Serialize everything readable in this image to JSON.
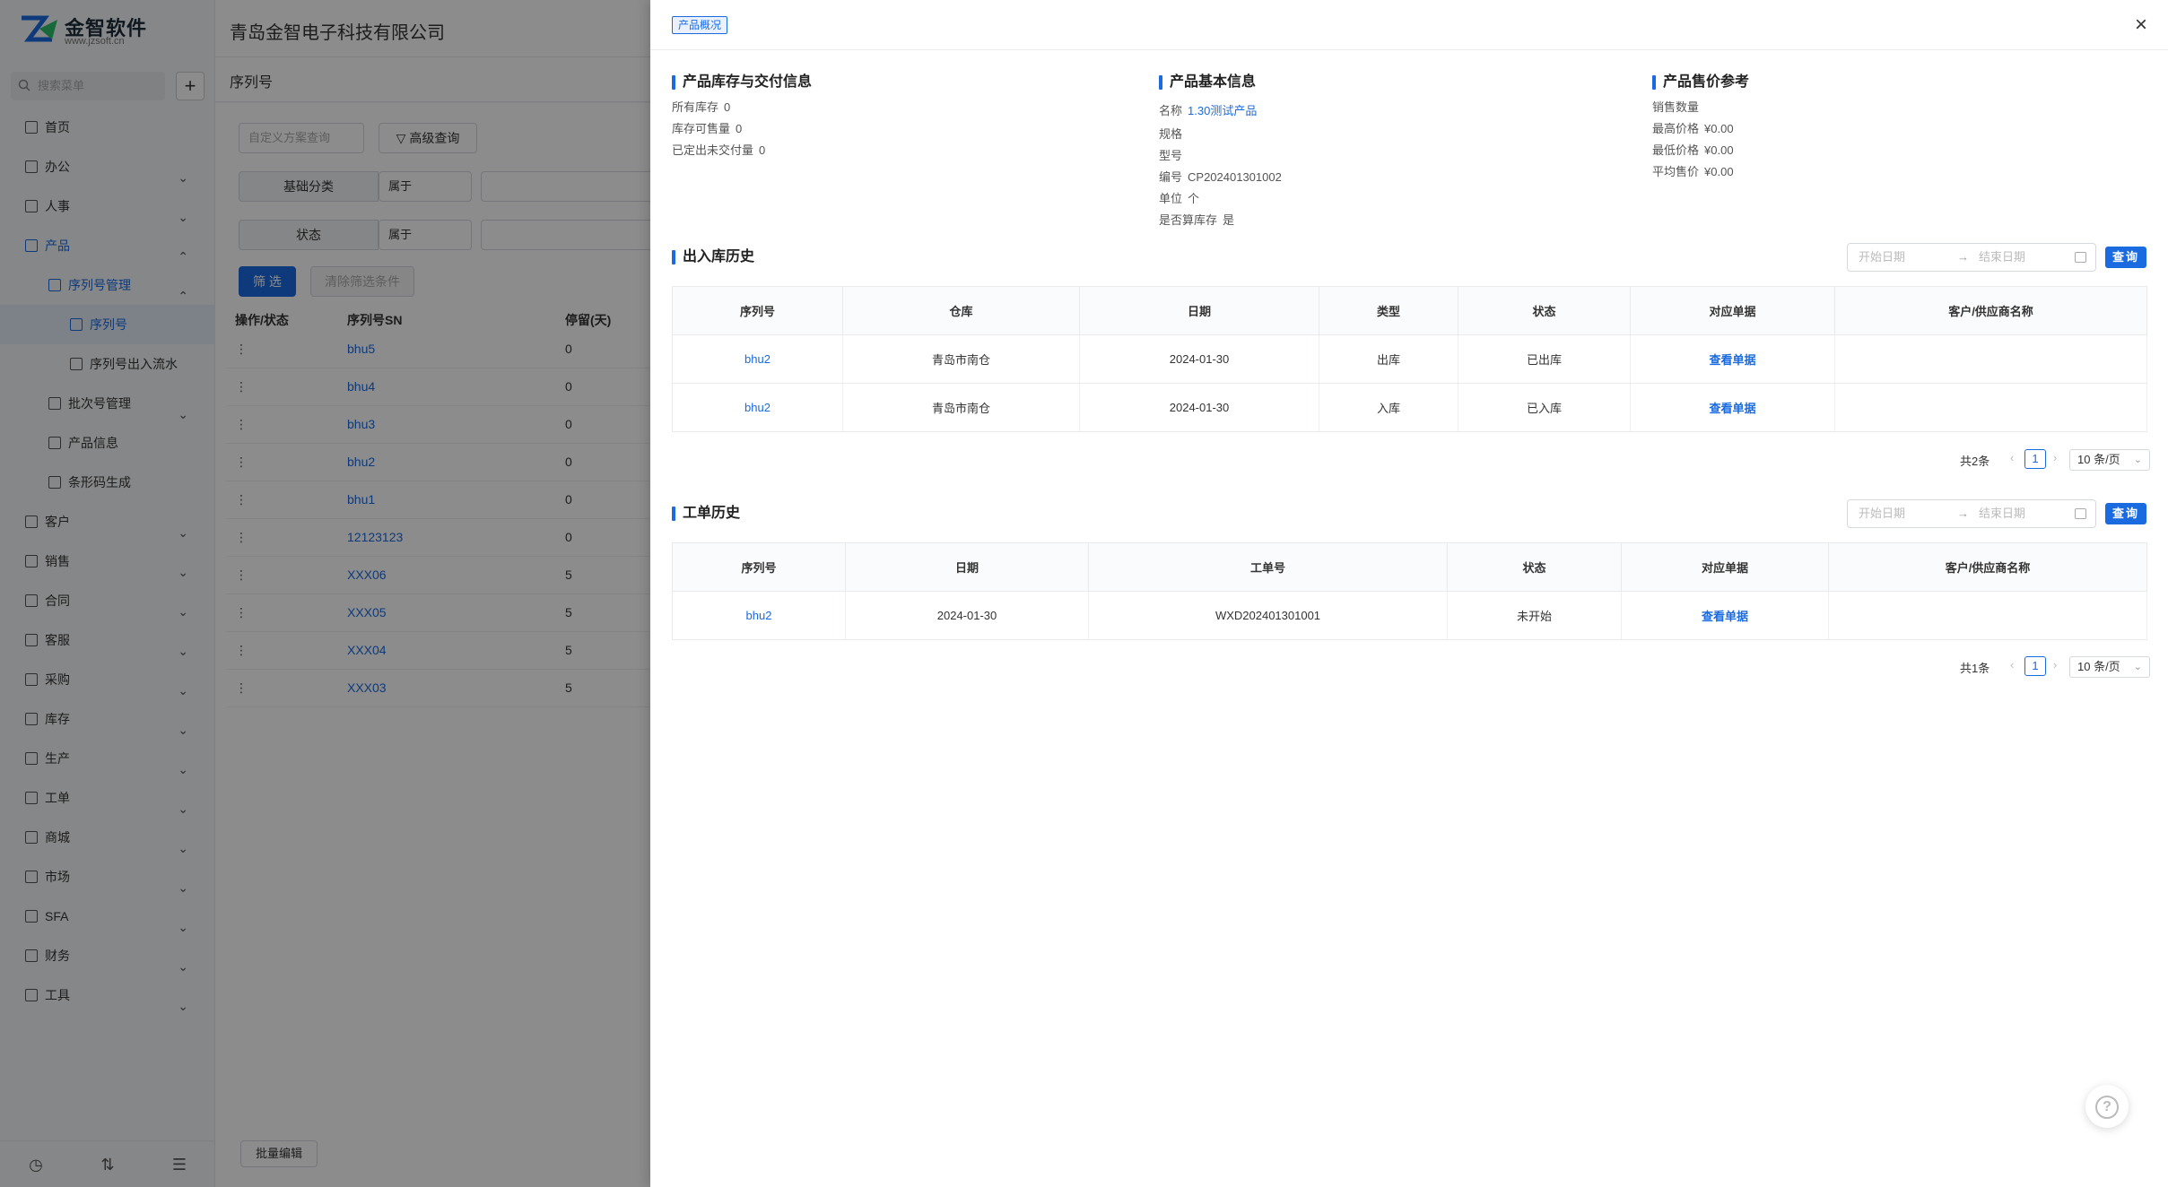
{
  "app": {
    "logo_cn": "金智软件",
    "logo_en": "www.jzsoft.cn",
    "company": "青岛金智电子科技有限公司",
    "menu_search_placeholder": "搜索菜单",
    "plus": "+",
    "nav": [
      {
        "label": "首页"
      },
      {
        "label": "办公"
      },
      {
        "label": "人事"
      },
      {
        "label": "产品"
      },
      {
        "label": "序列号管理"
      },
      {
        "label": "序列号"
      },
      {
        "label": "序列号出入流水"
      },
      {
        "label": "批次号管理"
      },
      {
        "label": "产品信息"
      },
      {
        "label": "条形码生成"
      },
      {
        "label": "客户"
      },
      {
        "label": "销售"
      },
      {
        "label": "合同"
      },
      {
        "label": "客服"
      },
      {
        "label": "采购"
      },
      {
        "label": "库存"
      },
      {
        "label": "生产"
      },
      {
        "label": "工单"
      },
      {
        "label": "商城"
      },
      {
        "label": "市场"
      },
      {
        "label": "SFA"
      },
      {
        "label": "财务"
      },
      {
        "label": "工具"
      }
    ],
    "page_title": "序列号",
    "filters": {
      "scheme_placeholder": "自定义方案查询",
      "advanced": "高级查询",
      "f1_label": "基础分类",
      "f1_op": "属于",
      "f2_label": "状态",
      "f2_op": "属于",
      "filter_btn": "筛 选",
      "clear_btn": "清除筛选条件"
    },
    "table": {
      "headers": [
        "操作/状态",
        "序列号SN",
        "停留(天)"
      ],
      "rows": [
        {
          "op": "⋮",
          "sn": "bhu5",
          "days": "0"
        },
        {
          "op": "⋮",
          "sn": "bhu4",
          "days": "0"
        },
        {
          "op": "⋮",
          "sn": "bhu3",
          "days": "0"
        },
        {
          "op": "⋮",
          "sn": "bhu2",
          "days": "0"
        },
        {
          "op": "⋮",
          "sn": "bhu1",
          "days": "0"
        },
        {
          "op": "⋮",
          "sn": "12123123",
          "days": "0"
        },
        {
          "op": "⋮",
          "sn": "XXX06",
          "days": "5"
        },
        {
          "op": "⋮",
          "sn": "XXX05",
          "days": "5"
        },
        {
          "op": "⋮",
          "sn": "XXX04",
          "days": "5"
        },
        {
          "op": "⋮",
          "sn": "XXX03",
          "days": "5"
        }
      ]
    },
    "batch_edit": "批量编辑"
  },
  "drawer": {
    "tag": "产品概况",
    "close": "×",
    "stock": {
      "title": "产品库存与交付信息",
      "lines": [
        {
          "label": "所有库存",
          "value": "0"
        },
        {
          "label": "库存可售量",
          "value": "0"
        },
        {
          "label": "已定出未交付量",
          "value": "0"
        }
      ]
    },
    "basic": {
      "title": "产品基本信息",
      "name_label": "名称",
      "name_value": "1.30测试产品",
      "spec_label": "规格",
      "model_label": "型号",
      "code_label": "编号",
      "code_value": "CP202401301002",
      "unit_label": "单位",
      "unit_value": "个",
      "calc_label": "是否算库存",
      "calc_value": "是"
    },
    "price": {
      "title": "产品售价参考",
      "qty_label": "销售数量",
      "lines": [
        {
          "label": "最高价格",
          "value": "¥0.00"
        },
        {
          "label": "最低价格",
          "value": "¥0.00"
        },
        {
          "label": "平均售价",
          "value": "¥0.00"
        }
      ]
    },
    "date_start": "开始日期",
    "date_arrow": "→",
    "date_end": "结束日期",
    "query": "查询",
    "io": {
      "title": "出入库历史",
      "headers": [
        "序列号",
        "仓库",
        "日期",
        "类型",
        "状态",
        "对应单据",
        "客户/供应商名称"
      ],
      "rows": [
        {
          "sn": "bhu2",
          "wh": "青岛市南仓",
          "date": "2024-01-30",
          "type": "出库",
          "status": "已出库",
          "doc": "查看单据",
          "party": ""
        },
        {
          "sn": "bhu2",
          "wh": "青岛市南仓",
          "date": "2024-01-30",
          "type": "入库",
          "status": "已入库",
          "doc": "查看单据",
          "party": ""
        }
      ],
      "total": "共2条",
      "page": "1",
      "size": "10 条/页"
    },
    "wo": {
      "title": "工单历史",
      "headers": [
        "序列号",
        "日期",
        "工单号",
        "状态",
        "对应单据",
        "客户/供应商名称"
      ],
      "rows": [
        {
          "sn": "bhu2",
          "date": "2024-01-30",
          "no": "WXD202401301001",
          "status": "未开始",
          "doc": "查看单据",
          "party": ""
        }
      ],
      "total": "共1条",
      "page": "1",
      "size": "10 条/页"
    },
    "help": "?"
  }
}
